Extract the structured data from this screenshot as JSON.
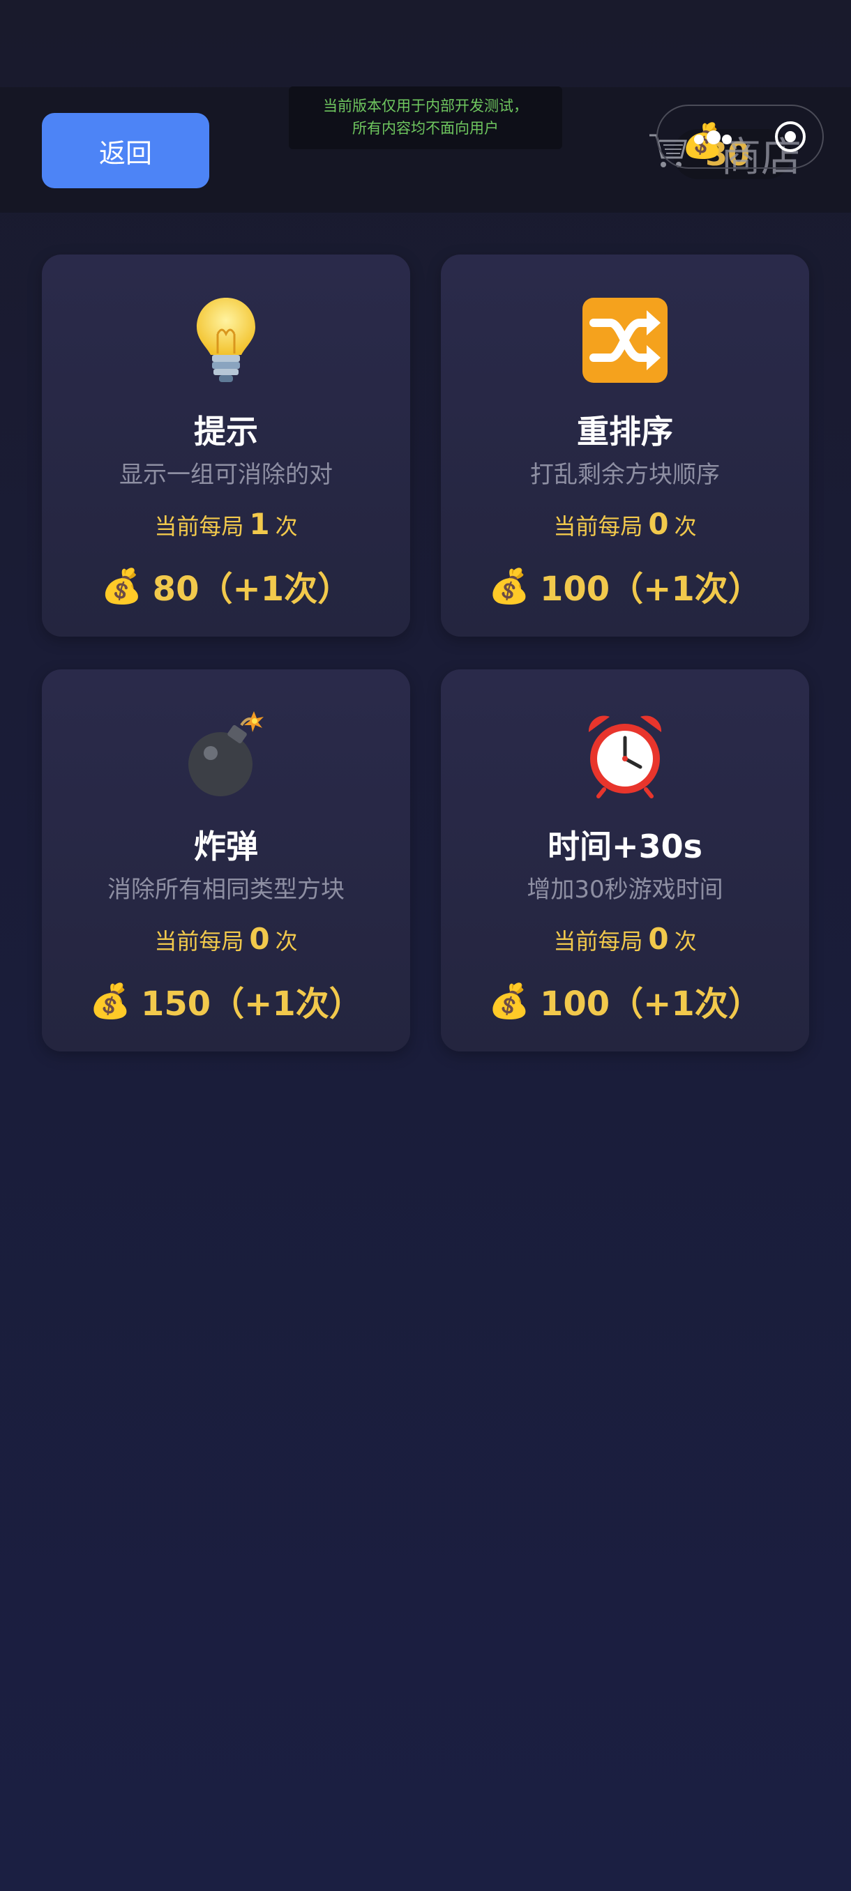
{
  "header": {
    "back_label": "返回",
    "notice_line1": "当前版本仅用于内部开发测试，",
    "notice_line2": "所有内容均不面向用户",
    "coins": "30",
    "shop_label": "商店"
  },
  "items": [
    {
      "icon": "lightbulb-icon",
      "title": "提示",
      "desc": "显示一组可消除的对",
      "count_prefix": "当前每局",
      "count": "1",
      "count_suffix": "次",
      "price": "80（+1次）"
    },
    {
      "icon": "shuffle-icon",
      "title": "重排序",
      "desc": "打乱剩余方块顺序",
      "count_prefix": "当前每局",
      "count": "0",
      "count_suffix": "次",
      "price": "100（+1次）"
    },
    {
      "icon": "bomb-icon",
      "title": "炸弹",
      "desc": "消除所有相同类型方块",
      "count_prefix": "当前每局",
      "count": "0",
      "count_suffix": "次",
      "price": "150（+1次）"
    },
    {
      "icon": "alarm-clock-icon",
      "title": "时间+30s",
      "desc": "增加30秒游戏时间",
      "count_prefix": "当前每局",
      "count": "0",
      "count_suffix": "次",
      "price": "100（+1次）"
    }
  ],
  "colors": {
    "accent": "#4d84f6",
    "gold": "#f2c94c",
    "notice_text": "#6fc75f"
  }
}
